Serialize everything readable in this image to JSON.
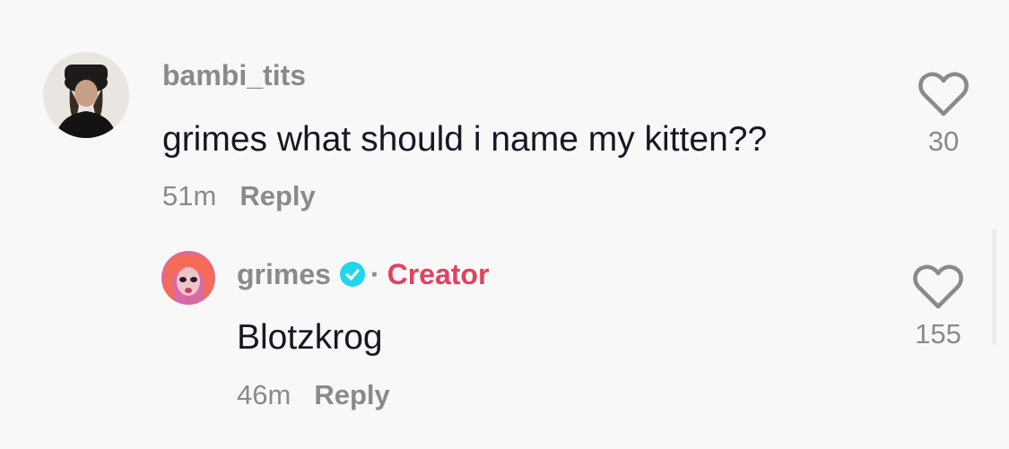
{
  "comments": [
    {
      "username": "bambi_tits",
      "text": "grimes what should i name my kitten??",
      "time": "51m",
      "reply_label": "Reply",
      "likes": "30"
    }
  ],
  "replies": [
    {
      "username": "grimes",
      "verified": true,
      "separator": "·",
      "badge": "Creator",
      "text": "Blotzkrog",
      "time": "46m",
      "reply_label": "Reply",
      "likes": "155"
    }
  ],
  "colors": {
    "background": "#f8f8f8",
    "muted_text": "#8a8a8a",
    "primary_text": "#161823",
    "creator_badge": "#e5405e",
    "verified_badge": "#20d5ec"
  },
  "icons": {
    "like": "heart-outline-icon",
    "verified": "verified-check-icon"
  }
}
